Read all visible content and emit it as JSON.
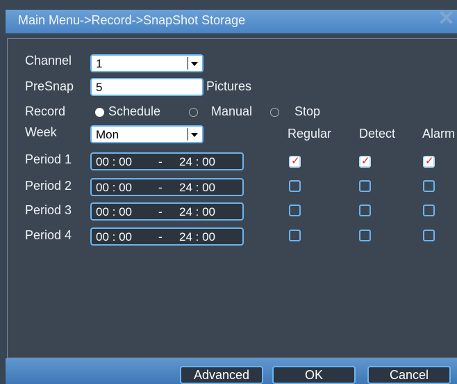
{
  "title": "Main Menu->Record->SnapShot Storage",
  "fields": {
    "channel": {
      "label": "Channel",
      "value": "1"
    },
    "presnap": {
      "label": "PreSnap",
      "value": "5",
      "unit": "Pictures"
    },
    "record": {
      "label": "Record",
      "options": [
        "Schedule",
        "Manual",
        "Stop"
      ],
      "selected": "Schedule"
    },
    "week": {
      "label": "Week",
      "value": "Mon"
    }
  },
  "columns": [
    "Regular",
    "Detect",
    "Alarm"
  ],
  "periods": [
    {
      "label": "Period 1",
      "start": "00 : 00",
      "sep": "-",
      "end": "24 : 00",
      "regular": true,
      "detect": true,
      "alarm": true
    },
    {
      "label": "Period 2",
      "start": "00 : 00",
      "sep": "-",
      "end": "24 : 00",
      "regular": false,
      "detect": false,
      "alarm": false
    },
    {
      "label": "Period 3",
      "start": "00 : 00",
      "sep": "-",
      "end": "24 : 00",
      "regular": false,
      "detect": false,
      "alarm": false
    },
    {
      "label": "Period 4",
      "start": "00 : 00",
      "sep": "-",
      "end": "24 : 00",
      "regular": false,
      "detect": false,
      "alarm": false
    }
  ],
  "buttons": {
    "advanced": "Advanced",
    "ok": "OK",
    "cancel": "Cancel"
  }
}
